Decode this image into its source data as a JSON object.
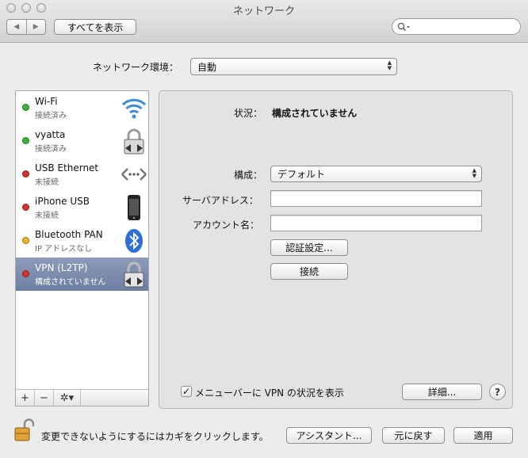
{
  "window": {
    "title": "ネットワーク"
  },
  "toolbar": {
    "show_all_label": "すべてを表示",
    "back_glyph": "◀",
    "forward_glyph": "▶"
  },
  "search": {
    "placeholder": ""
  },
  "location": {
    "label": "ネットワーク環境：",
    "value": "自動"
  },
  "services": [
    {
      "name": "Wi-Fi",
      "status": "接続済み",
      "indicator": "#3cb43c",
      "icon": "wifi-icon"
    },
    {
      "name": "vyatta",
      "status": "接続済み",
      "indicator": "#3cb43c",
      "icon": "vpn-lock-icon"
    },
    {
      "name": "USB Ethernet",
      "status": "未接続",
      "indicator": "#d8322a",
      "icon": "ethernet-icon"
    },
    {
      "name": "iPhone USB",
      "status": "未接続",
      "indicator": "#d8322a",
      "icon": "iphone-icon"
    },
    {
      "name": "Bluetooth PAN",
      "status": "IP アドレスなし",
      "indicator": "#f0b429",
      "icon": "bluetooth-icon"
    },
    {
      "name": "VPN (L2TP)",
      "status": "構成されていません",
      "indicator": "#d8322a",
      "icon": "vpn-lock-icon",
      "selected": true
    }
  ],
  "sidebar_footer": {
    "add": "+",
    "remove": "−",
    "action": "✲▾"
  },
  "detail": {
    "status_label": "状況：",
    "status_value": "構成されていません",
    "config_label": "構成：",
    "config_value": "デフォルト",
    "server_label": "サーバアドレス：",
    "server_value": "",
    "account_label": "アカウント名：",
    "account_value": "",
    "auth_button": "認証設定...",
    "connect_button": "接続",
    "menubar_checkbox_label": "メニューバーに VPN の状況を表示",
    "menubar_checked": true,
    "advanced_button": "詳細...",
    "help": "?"
  },
  "footer": {
    "lock_text": "変更できないようにするにはカギをクリックします。",
    "assistant_button": "アシスタント...",
    "revert_button": "元に戻す",
    "apply_button": "適用"
  }
}
